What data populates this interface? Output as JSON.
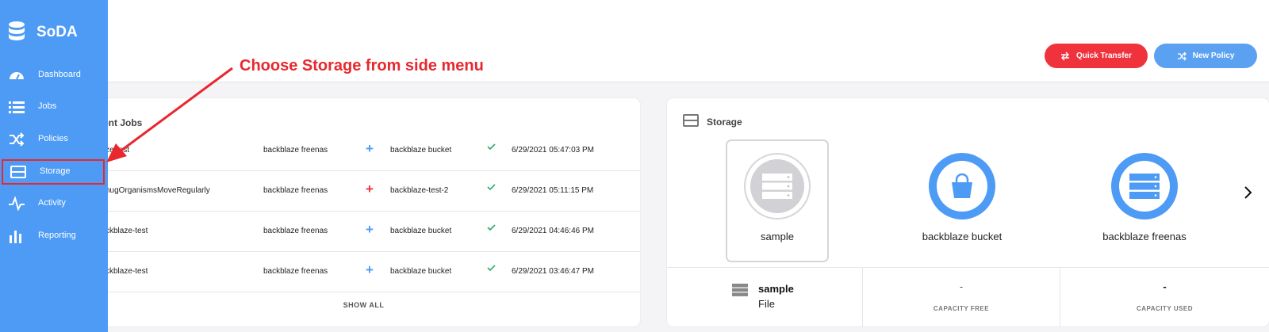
{
  "app": {
    "name": "SoDA",
    "title_fragment": "A"
  },
  "header": {
    "quick_transfer_label": "Quick Transfer",
    "new_policy_label": "New Policy"
  },
  "sidebar": {
    "items": [
      {
        "label": "Dashboard",
        "icon": "gauge-icon"
      },
      {
        "label": "Jobs",
        "icon": "list-icon"
      },
      {
        "label": "Policies",
        "icon": "shuffle-icon"
      },
      {
        "label": "Storage",
        "icon": "storage-icon",
        "active": true
      },
      {
        "label": "Activity",
        "icon": "pulse-icon"
      },
      {
        "label": "Reporting",
        "icon": "bar-chart-icon"
      }
    ]
  },
  "annotation": {
    "text": "Choose Storage from side menu",
    "color": "#e8282e"
  },
  "jobs": {
    "title": "ent Jobs",
    "rows": [
      {
        "name": "ze-test",
        "source": "backblaze freenas",
        "op": "+",
        "op_color": "#4d9bf5",
        "destination": "backblaze bucket",
        "status": "✓",
        "time": "6/29/2021 05:47:03 PM"
      },
      {
        "name": "hugOrganismsMoveRegularly",
        "source": "backblaze freenas",
        "op": "+",
        "op_color": "#f0323c",
        "destination": "backblaze-test-2",
        "status": "✓",
        "time": "6/29/2021 05:11:15 PM"
      },
      {
        "name": "ckblaze-test",
        "source": "backblaze freenas",
        "op": "+",
        "op_color": "#4d9bf5",
        "destination": "backblaze bucket",
        "status": "✓",
        "time": "6/29/2021 04:46:46 PM"
      },
      {
        "name": "ckblaze-test",
        "source": "backblaze freenas",
        "op": "+",
        "op_color": "#4d9bf5",
        "destination": "backblaze bucket",
        "status": "✓",
        "time": "6/29/2021 03:46:47 PM"
      }
    ],
    "show_all_label": "SHOW ALL"
  },
  "storage": {
    "title": "Storage",
    "tiles": [
      {
        "label": "sample",
        "icon": "server-icon",
        "selected": true
      },
      {
        "label": "backblaze bucket",
        "icon": "bucket-icon",
        "selected": false
      },
      {
        "label": "backblaze freenas",
        "icon": "server-icon",
        "selected": false
      }
    ],
    "selected": {
      "name": "sample",
      "type": "File",
      "capacity_free_value": "-",
      "capacity_free_label": "CAPACITY FREE",
      "capacity_used_value": "-",
      "capacity_used_label": "CAPACITY USED"
    }
  },
  "colors": {
    "sidebar": "#4d9bf5",
    "accent_red": "#f0323c",
    "accent_blue": "#5aa1f2",
    "success": "#2eaa6e"
  }
}
